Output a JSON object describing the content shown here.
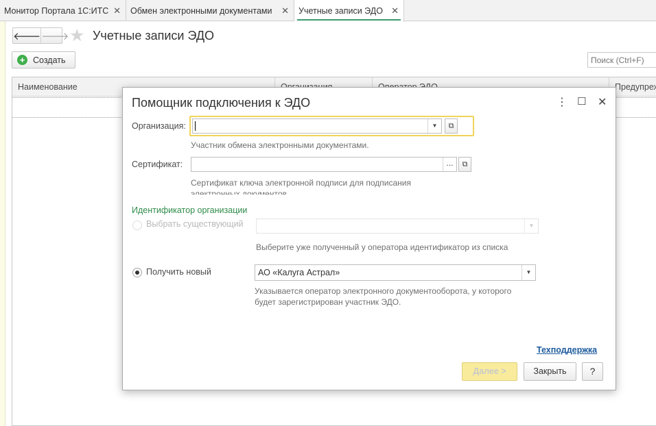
{
  "tabs": [
    {
      "label": "Монитор Портала 1С:ИТС",
      "close": "✕"
    },
    {
      "label": "Обмен электронными документами",
      "close": "✕"
    },
    {
      "label": "Учетные записи ЭДО",
      "close": "✕"
    }
  ],
  "page": {
    "title": "Учетные записи ЭДО",
    "back_icon": "🡐",
    "forward_icon": "🡒",
    "star_icon": "★",
    "create_label": "Создать",
    "search_placeholder": "Поиск (Ctrl+F)"
  },
  "list": {
    "columns": [
      "Наименование",
      "Организация",
      "Оператор ЭДО",
      "Предупреж"
    ]
  },
  "dialog": {
    "title": "Помощник подключения к ЭДО",
    "menu_icon": "⋮",
    "maximize_icon": "☐",
    "close_icon": "✕",
    "organization": {
      "label": "Организация:",
      "value": "",
      "hint": "Участник обмена электронными документами."
    },
    "certificate": {
      "label": "Сертификат:",
      "value": "",
      "hint_line1": "Сертификат ключа электронной подписи для подписания",
      "hint_line2": "электронных документов."
    },
    "identifier": {
      "group_title": "Идентификатор организации",
      "option_existing": "Выбрать существующий",
      "existing_value": "",
      "existing_hint": "Выберите уже полученный у оператора идентификатор из списка",
      "option_new": "Получить новый",
      "new_value": "АО «Калуга Астрал»",
      "new_hint_line1": "Указывается оператор электронного документооборота, у которого",
      "new_hint_line2": "будет зарегистрирован участник ЭДО.",
      "selected": "new"
    },
    "support_link": "Техподдержка",
    "next_button": "Далее >",
    "close_button": "Закрыть",
    "help_button": "?"
  },
  "colors": {
    "accent_green": "#3d9970",
    "highlight_red": "#d9272e",
    "focus_yellow": "#f1d35a",
    "link_blue": "#1c5a9c"
  }
}
